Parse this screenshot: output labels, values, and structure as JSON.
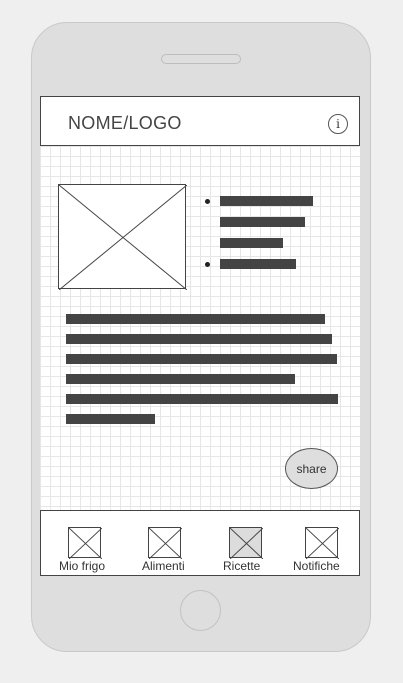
{
  "app": {
    "title": "NOME/LOGO",
    "info_icon": "i"
  },
  "content": {
    "image_icon": "image-placeholder-icon",
    "share_label": "share"
  },
  "tabs": [
    {
      "label": "Mio frigo",
      "active": false
    },
    {
      "label": "Alimenti",
      "active": false
    },
    {
      "label": "Ricette",
      "active": true
    },
    {
      "label": "Notifiche",
      "active": false
    }
  ],
  "colors": {
    "frame": "#dedede",
    "ink": "#444444",
    "grid": "#e6e6e6",
    "active_tab": "#dcdcdc"
  }
}
